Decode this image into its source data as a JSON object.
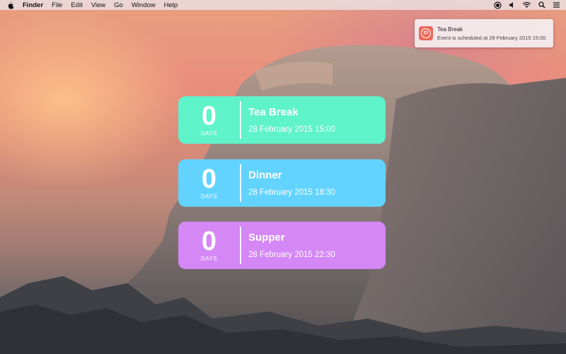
{
  "menubar": {
    "apple_icon": "apple-icon",
    "items": [
      "Finder",
      "File",
      "Edit",
      "View",
      "Go",
      "Window",
      "Help"
    ],
    "status_icons": [
      "record-icon",
      "volume-icon",
      "wifi-icon",
      "search-icon",
      "list-icon"
    ]
  },
  "notification": {
    "icon": "calendar-countdown-icon",
    "icon_number": "23",
    "title": "Tea Break",
    "body": "Event is scheduled at 28 February 2015 15:00",
    "icon_color": "#ec6a5a"
  },
  "events": [
    {
      "count": "0",
      "unit": "DAYS",
      "title": "Tea Break",
      "date": "28 February 2015 15:00",
      "color": "#5ff3c9"
    },
    {
      "count": "0",
      "unit": "DAYS",
      "title": "Dinner",
      "date": "28 February 2015 18:30",
      "color": "#62d3ff"
    },
    {
      "count": "0",
      "unit": "DAYS",
      "title": "Supper",
      "date": "28 February 2015 22:30",
      "color": "#d487f5"
    }
  ]
}
